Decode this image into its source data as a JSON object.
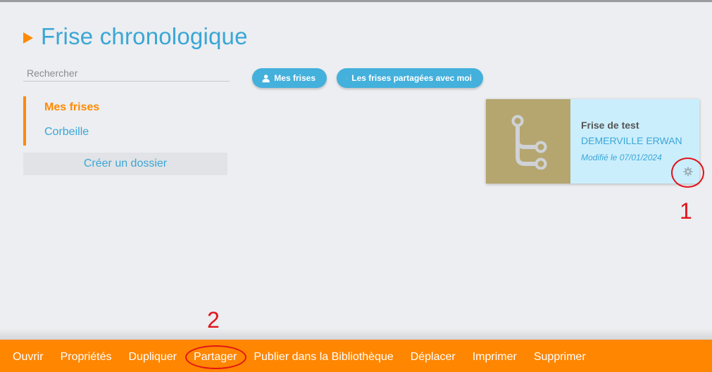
{
  "page": {
    "title": "Frise chronologique"
  },
  "search": {
    "placeholder": "Rechercher"
  },
  "sidebar": {
    "items": [
      {
        "label": "Mes frises",
        "active": true
      },
      {
        "label": "Corbeille",
        "active": false
      }
    ],
    "create_folder_label": "Créer un dossier"
  },
  "filters": [
    {
      "label": "Mes frises",
      "icon": "user-icon"
    },
    {
      "label": "Les frises partagées avec moi",
      "icon": "share-icon"
    }
  ],
  "card": {
    "title": "Frise de test",
    "author": "DEMERVILLE ERWAN",
    "modified": "Modifié le 07/01/2024",
    "thumbnail_icon": "timeline-icon",
    "menu_icon": "gear-icon"
  },
  "annotations": {
    "step1": "1",
    "step2": "2"
  },
  "toolbar": {
    "items": [
      "Ouvrir",
      "Propriétés",
      "Dupliquer",
      "Partager",
      "Publier dans la Bibliothèque",
      "Déplacer",
      "Imprimer",
      "Supprimer"
    ]
  },
  "colors": {
    "accent": "#ff8600",
    "primary": "#3aa6d6",
    "card_bg": "#cbeefd",
    "thumb_bg": "#b5a670",
    "annotation": "#e0141c"
  }
}
